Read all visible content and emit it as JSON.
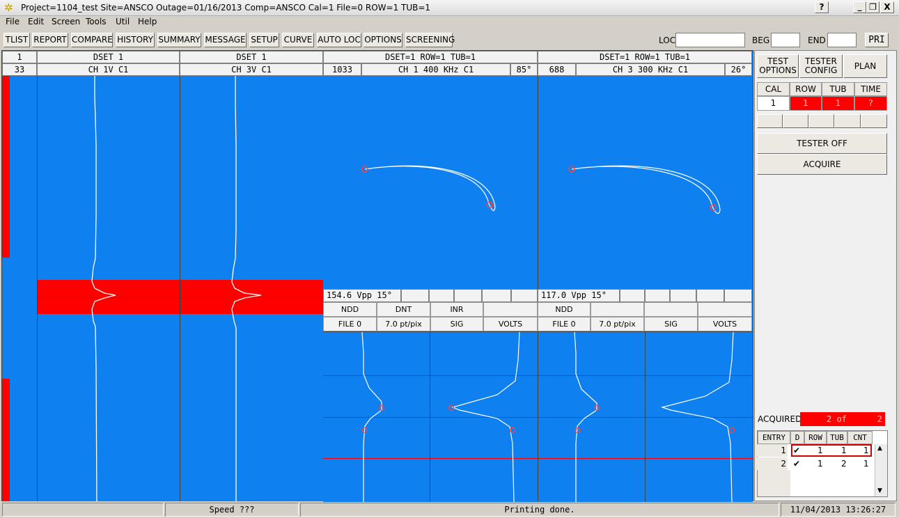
{
  "window": {
    "title": "Project=1104_test Site=ANSCO Outage=01/16/2013 Comp=ANSCO Cal=1 File=0 ROW=1  TUB=1",
    "help_btn": "?",
    "min_btn": "_",
    "restore_btn": "❐",
    "close_btn": "X"
  },
  "menu": [
    "File",
    "Edit",
    "Screen",
    "Tools",
    "Util",
    "Help"
  ],
  "toolbar": {
    "buttons": [
      "TLIST",
      "REPORT",
      "COMPARE",
      "HISTORY",
      "SUMMARY",
      "MESSAGE",
      "SETUP",
      "CURVE",
      "AUTO LOC",
      "OPTIONS",
      "SCREENING"
    ],
    "loc_label": "LOC",
    "beg_label": "BEG",
    "end_label": "END",
    "pri_btn": "PRI"
  },
  "strip": {
    "header": "1",
    "sub": "33"
  },
  "strip_charts": [
    {
      "header": "DSET 1",
      "sub": "CH 1V C1"
    },
    {
      "header": "DSET 1",
      "sub": "CH 3V C1"
    }
  ],
  "lissajous": [
    {
      "header": "DSET=1 ROW=1 TUB=1",
      "sub_left": "1033",
      "sub_mid": "CH 1 400 KHz C1",
      "sub_right": "85°",
      "vpp": "154.6 Vpp  15°",
      "buttons": [
        "NDD",
        "DNT",
        "INR",
        ""
      ],
      "buttons2": [
        "FILE 0",
        "7.0 pt/pix",
        "SIG",
        "VOLTS"
      ]
    },
    {
      "header": "DSET=1 ROW=1 TUB=1",
      "sub_left": "688",
      "sub_mid": "CH 3 300 KHz C1",
      "sub_right": "26°",
      "vpp": "117.0 Vpp  15°",
      "buttons": [
        "NDD",
        "",
        "",
        ""
      ],
      "buttons2": [
        "FILE 0",
        "7.0 pt/pix",
        "SIG",
        "VOLTS"
      ]
    }
  ],
  "right_panel": {
    "test_options": "TEST OPTIONS",
    "tester_config": "TESTER CONFIG",
    "plan": "PLAN",
    "headers": [
      "CAL",
      "ROW",
      "TUB",
      "TIME"
    ],
    "values": [
      "1",
      "1",
      "1",
      "?"
    ],
    "tester_off": "TESTER OFF",
    "acquire": "ACQUIRE",
    "acquired_label": "ACQUIRED",
    "acquired_value": "2  of",
    "acquired_total": "2",
    "entry_headers": [
      "ENTRY",
      "D",
      "ROW",
      "TUB",
      "CNT"
    ],
    "entries": [
      {
        "entry": "1",
        "d": "✔",
        "row": "1",
        "tub": "1",
        "cnt": "1"
      },
      {
        "entry": "2",
        "d": "✔",
        "row": "1",
        "tub": "2",
        "cnt": "1"
      }
    ],
    "scroll_up": "▲",
    "scroll_down": "▼"
  },
  "status": {
    "speed": "Speed ???",
    "message": "Printing done.",
    "datetime": "11/04/2013 13:26:27"
  },
  "colors": {
    "plot_bg": "#0f80ef",
    "alarm": "#ff0000",
    "trace": "#ffffff",
    "cursor": "#ff4040"
  }
}
